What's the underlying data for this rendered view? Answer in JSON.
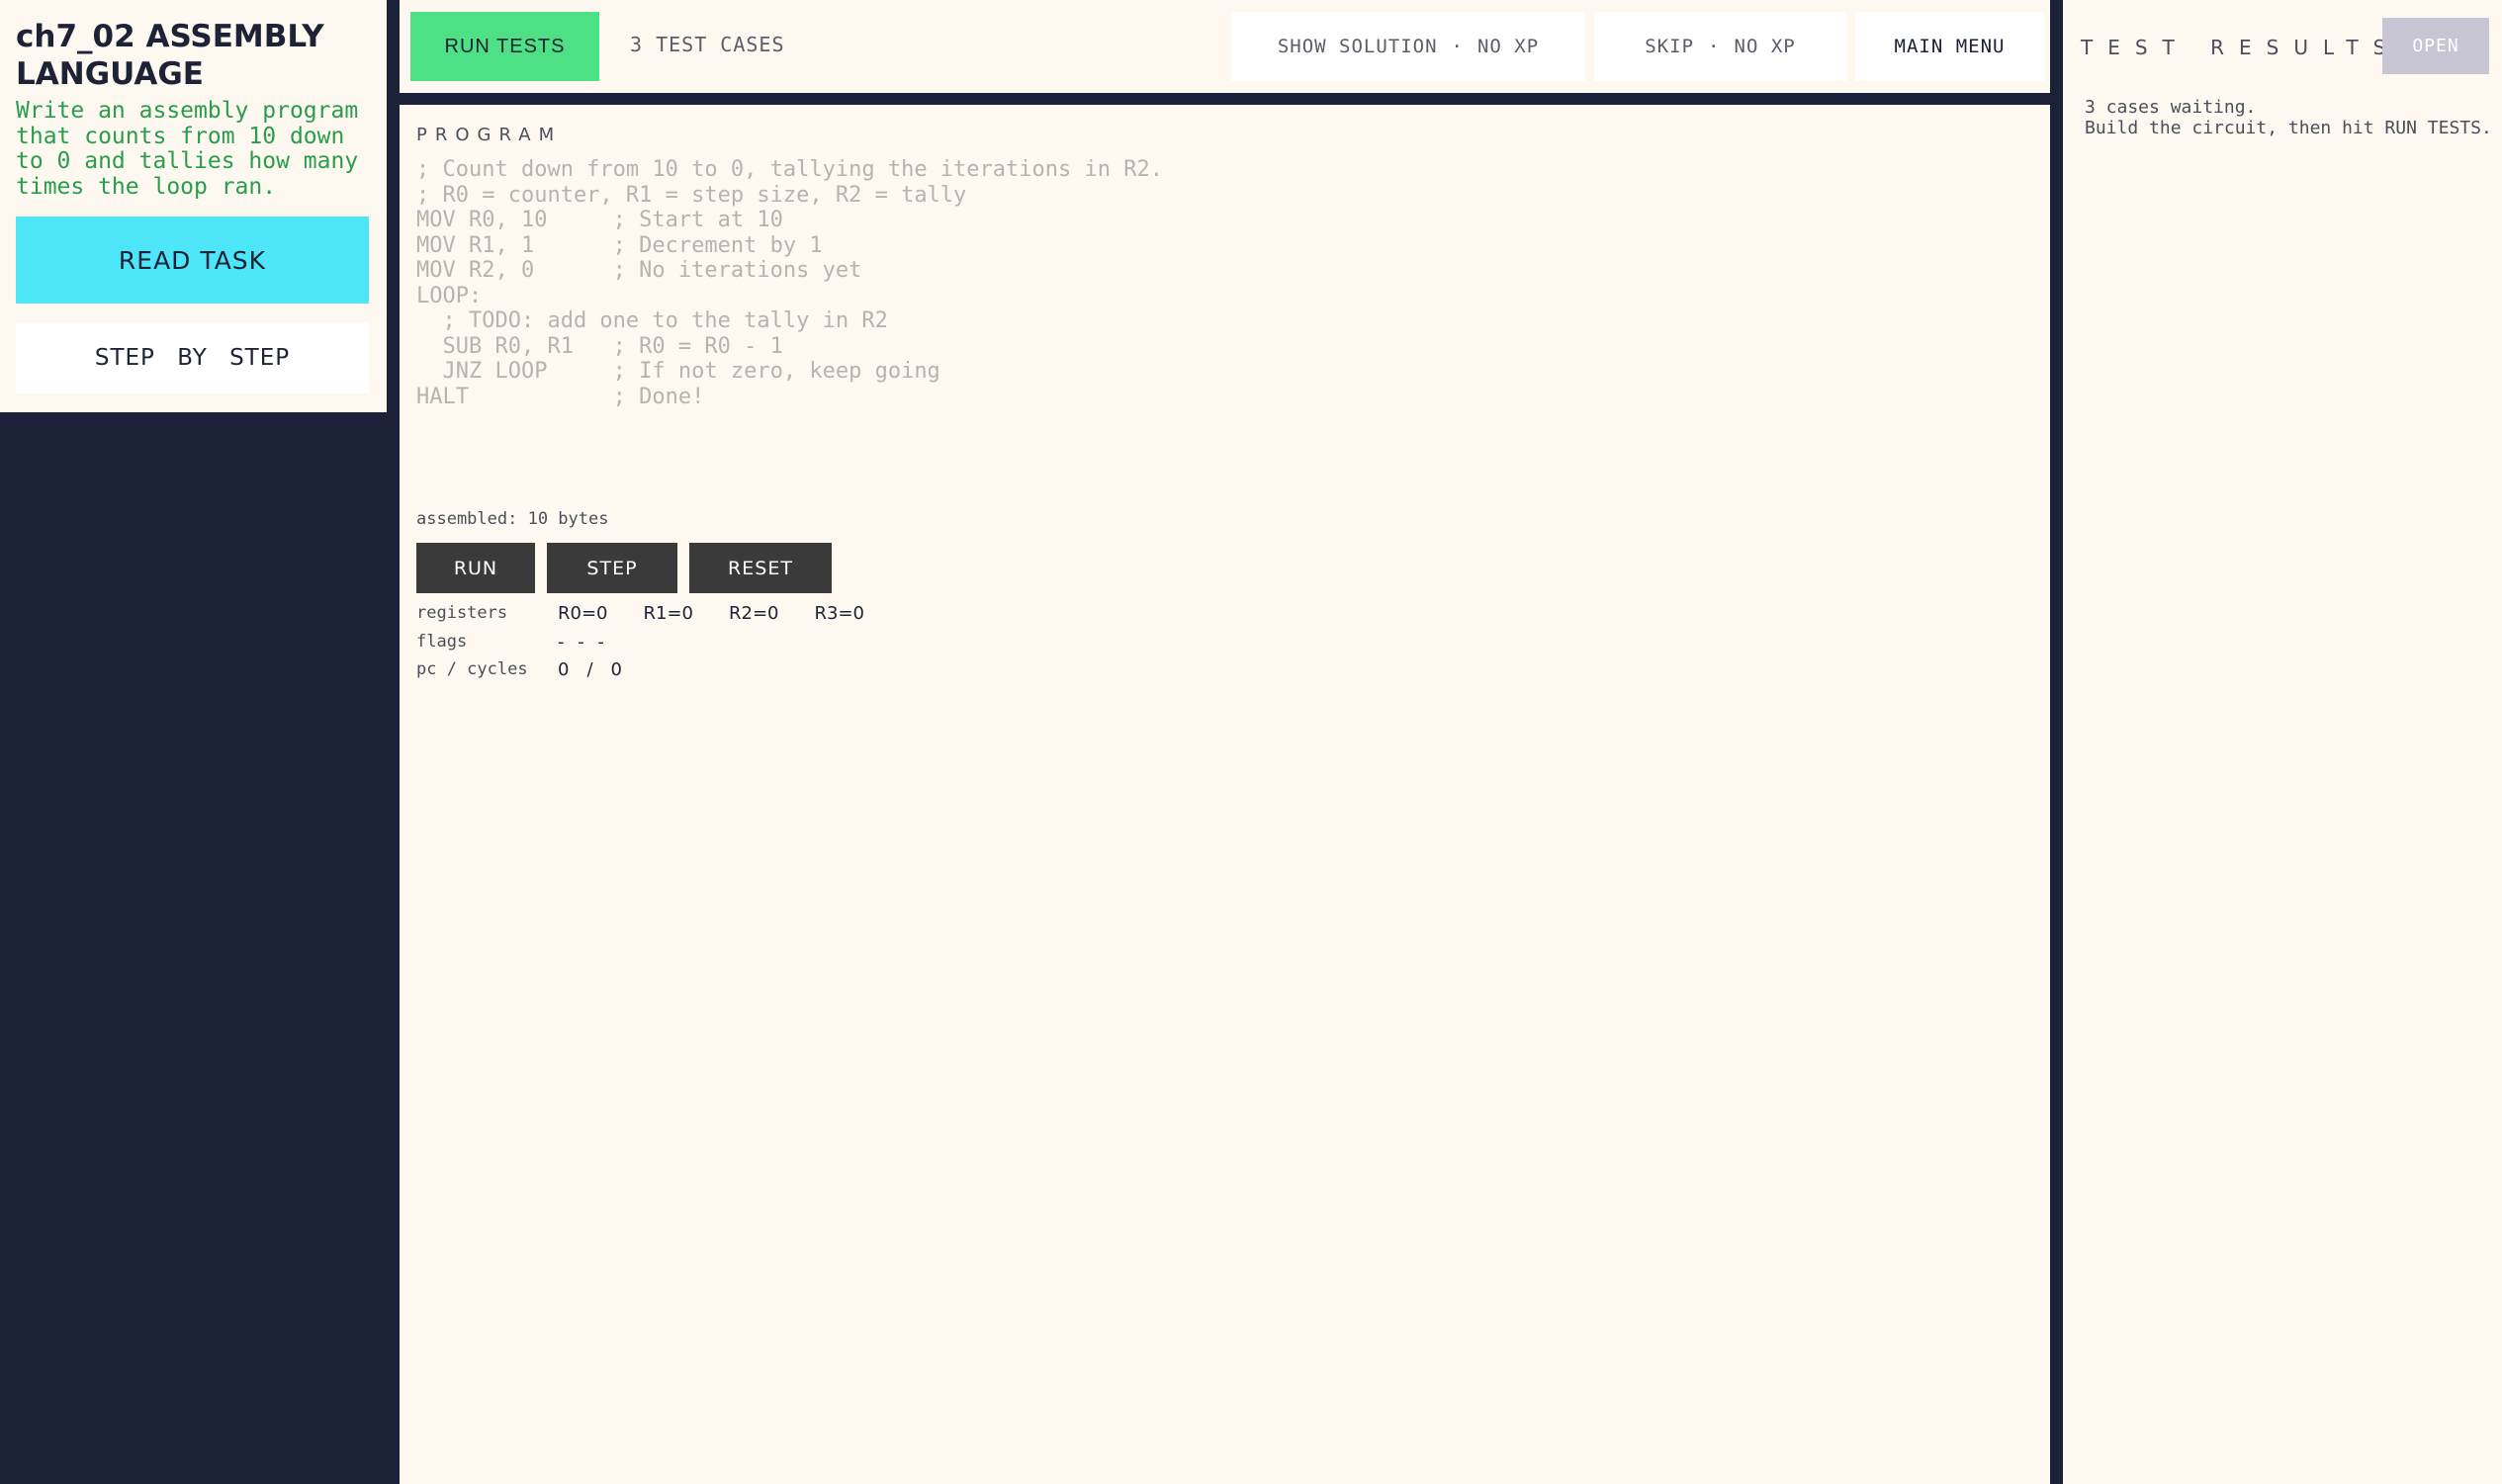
{
  "task": {
    "chapter": "ch7_02",
    "title": "ASSEMBLY LANGUAGE",
    "description": "Write an assembly program that counts from 10 down to 0 and tallies how many times the loop ran.",
    "read_task_label": "READ TASK",
    "step_by_step_label": "STEP BY STEP"
  },
  "topbar": {
    "run_tests_label": "RUN TESTS",
    "test_cases_label": "3 TEST CASES",
    "show_solution_label": "SHOW SOLUTION",
    "show_solution_xp": "NO XP",
    "skip_label": "SKIP",
    "skip_xp": "NO XP",
    "separator": "·",
    "main_menu_label": "MAIN MENU"
  },
  "program": {
    "label": "PROGRAM",
    "code_lines": [
      "; Count down from 10 to 0, tallying the iterations in R2.",
      "; R0 = counter, R1 = step size, R2 = tally",
      "MOV R0, 10     ; Start at 10",
      "MOV R1, 1      ; Decrement by 1",
      "MOV R2, 0      ; No iterations yet",
      "LOOP:",
      "  ; TODO: add one to the tally in R2",
      "  SUB R0, R1   ; R0 = R0 - 1",
      "  JNZ LOOP     ; If not zero, keep going",
      "HALT           ; Done!"
    ],
    "assembled": "assembled: 10 bytes",
    "buttons": {
      "run": "RUN",
      "step": "STEP",
      "reset": "RESET"
    },
    "registers_label": "registers",
    "registers": [
      "R0=0",
      "R1=0",
      "R2=0",
      "R3=0"
    ],
    "flags_label": "flags",
    "flags_value": "- - -",
    "pc_label": "pc / cycles",
    "pc": "0",
    "pc_sep": "/",
    "cycles": "0"
  },
  "results": {
    "label": "TEST RESULTS",
    "open_label": "OPEN",
    "message_line1": "3 cases waiting.",
    "message_line2": "Build the circuit, then hit RUN TESTS."
  },
  "colors": {
    "background": "#1b2139",
    "panel": "#fdf9f1",
    "run_tests": "#4de085",
    "read_task": "#4de5f8",
    "description": "#2a9d4c",
    "open_button": "#c8c5d4"
  }
}
